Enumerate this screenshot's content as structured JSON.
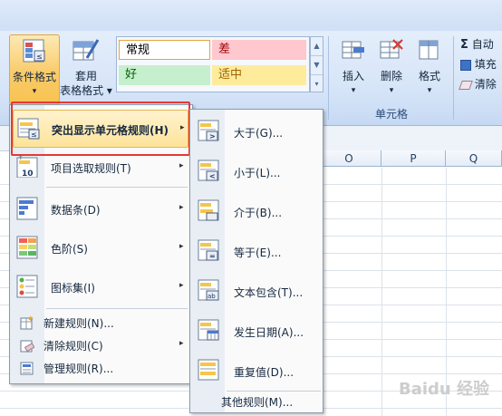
{
  "ribbon": {
    "conditional_format": {
      "line1": "条件格式",
      "line2": "▾"
    },
    "table_format": {
      "line1": "套用",
      "line2": "表格格式 ▾"
    },
    "styles": [
      {
        "label": "常规",
        "bg": "#ffffff",
        "fg": "#000000"
      },
      {
        "label": "差",
        "bg": "#ffc7ce",
        "fg": "#9c0006"
      },
      {
        "label": "好",
        "bg": "#c6efce",
        "fg": "#006100"
      },
      {
        "label": "适中",
        "bg": "#ffeb9c",
        "fg": "#9c6500"
      }
    ],
    "insert": {
      "label": "插入",
      "arrow": "▾"
    },
    "delete": {
      "label": "删除",
      "arrow": "▾"
    },
    "format": {
      "label": "格式",
      "arrow": "▾"
    },
    "cells_group_label": "单元格",
    "sum": {
      "symbol": "Σ",
      "label": "自动"
    },
    "fill": {
      "label": "填充"
    },
    "clear": {
      "label": "清除"
    }
  },
  "sheet": {
    "columns": [
      "O",
      "P",
      "Q"
    ]
  },
  "main_menu": {
    "items": [
      {
        "label": "突出显示单元格规则(H)",
        "arrow": "▸"
      },
      {
        "label": "项目选取规则(T)",
        "arrow": "▸"
      },
      {
        "label": "数据条(D)",
        "arrow": "▸"
      },
      {
        "label": "色阶(S)",
        "arrow": "▸"
      },
      {
        "label": "图标集(I)",
        "arrow": "▸"
      },
      {
        "label": "新建规则(N)..."
      },
      {
        "label": "清除规则(C)",
        "arrow": "▸"
      },
      {
        "label": "管理规则(R)..."
      }
    ]
  },
  "sub_menu": {
    "items": [
      {
        "label": "大于(G)..."
      },
      {
        "label": "小于(L)..."
      },
      {
        "label": "介于(B)..."
      },
      {
        "label": "等于(E)..."
      },
      {
        "label": "文本包含(T)..."
      },
      {
        "label": "发生日期(A)..."
      },
      {
        "label": "重复值(D)..."
      },
      {
        "label": "其他规则(M)..."
      }
    ]
  },
  "watermark": "Baidu 经验",
  "colors": {
    "highlight_border": "#e53935",
    "accent": "#f7c34f"
  }
}
